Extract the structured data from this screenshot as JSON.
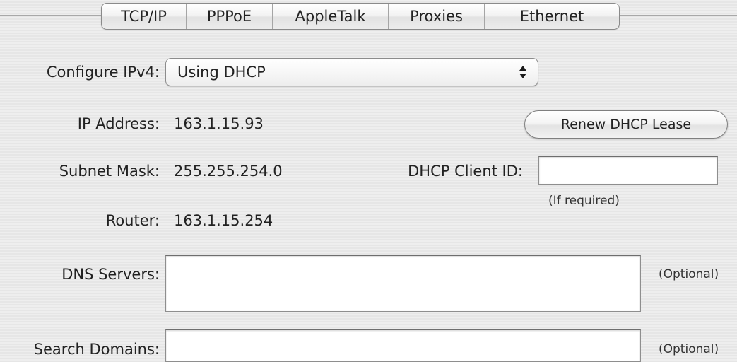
{
  "tabs": [
    {
      "label": "TCP/IP",
      "selected": true
    },
    {
      "label": "PPPoE",
      "selected": false
    },
    {
      "label": "AppleTalk",
      "selected": false
    },
    {
      "label": "Proxies",
      "selected": false
    },
    {
      "label": "Ethernet",
      "selected": false
    }
  ],
  "configure": {
    "label": "Configure IPv4:",
    "selected_value": "Using DHCP",
    "arrows_icon": "up-down-arrows-icon"
  },
  "ip_address": {
    "label": "IP Address:",
    "value": "163.1.15.93"
  },
  "renew_button": {
    "label": "Renew DHCP Lease"
  },
  "subnet_mask": {
    "label": "Subnet Mask:",
    "value": "255.255.254.0"
  },
  "dhcp_client_id": {
    "label": "DHCP Client ID:",
    "value": "",
    "hint": "(If required)"
  },
  "router": {
    "label": "Router:",
    "value": "163.1.15.254"
  },
  "dns_servers": {
    "label": "DNS Servers:",
    "value": "",
    "hint": "(Optional)"
  },
  "search_domains": {
    "label": "Search Domains:",
    "value": "",
    "hint": "(Optional)"
  }
}
